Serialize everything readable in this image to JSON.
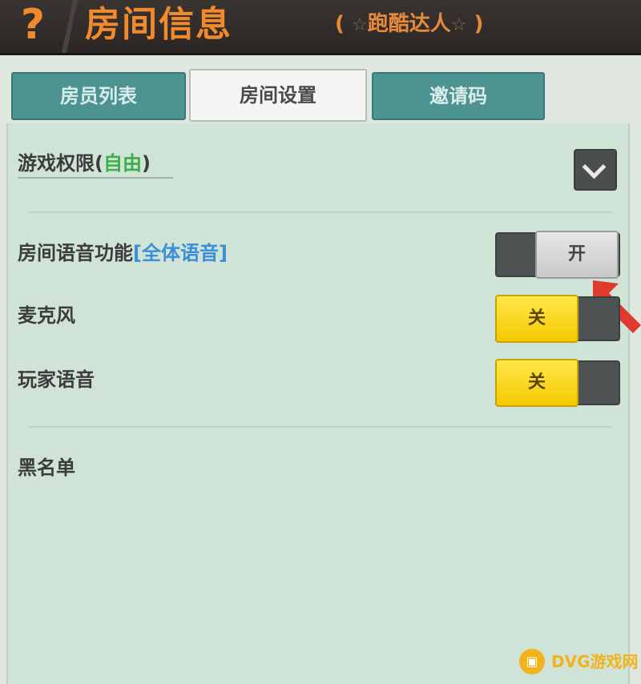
{
  "header": {
    "help_icon": "?",
    "title": "房间信息",
    "subtitle_open": "(",
    "subtitle_star": "☆",
    "subtitle_name": "跑酷达人",
    "subtitle_close": ")"
  },
  "tabs": [
    {
      "label": "房员列表",
      "active": false
    },
    {
      "label": "房间设置",
      "active": true
    },
    {
      "label": "邀请码",
      "active": false
    }
  ],
  "settings": {
    "permission": {
      "label": "游戏权限",
      "open": "(",
      "value": "自由",
      "close": ")"
    },
    "room_voice": {
      "label": "房间语音功能",
      "value": "[全体语音]",
      "toggle": "开"
    },
    "microphone": {
      "label": "麦克风",
      "toggle": "关"
    },
    "player_voice": {
      "label": "玩家语音",
      "toggle": "关"
    },
    "blacklist": {
      "label": "黑名单"
    }
  },
  "watermark": {
    "text": "DVG游戏网"
  },
  "colors": {
    "accent_orange": "#f08a2c",
    "tab_teal": "#4d9392",
    "panel_green": "#cfe4d6",
    "toggle_yellow": "#f3c900",
    "value_green": "#3cae4a",
    "value_blue": "#3b8fd6",
    "arrow_red": "#e03a2e"
  }
}
